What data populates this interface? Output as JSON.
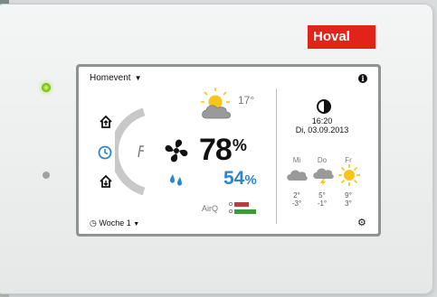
{
  "device": {
    "brand": "Hoval"
  },
  "screen": {
    "title": "Homevent",
    "outside_temp": "17°",
    "humidity_main": "78",
    "humidity_main_unit": "%",
    "humidity_secondary": "54",
    "humidity_secondary_unit": "%",
    "airq_label": "AirQ",
    "week_program": "Woche 1",
    "time": "16:20",
    "date": "Di, 03.09.2013",
    "forecast": [
      {
        "day": "Mi",
        "high": "2°",
        "low": "-3°",
        "icon": "cloud-icon"
      },
      {
        "day": "Do",
        "high": "5°",
        "low": "-1°",
        "icon": "cloud-lightning-icon"
      },
      {
        "day": "Fr",
        "high": "9°",
        "low": "3°",
        "icon": "sun-icon"
      }
    ]
  },
  "colors": {
    "brand_red": "#e2231a",
    "humidity_blue": "#2a86d1",
    "airq_red": "#b0413e",
    "airq_green": "#3c9a3c",
    "sun_yellow": "#f5c518"
  }
}
